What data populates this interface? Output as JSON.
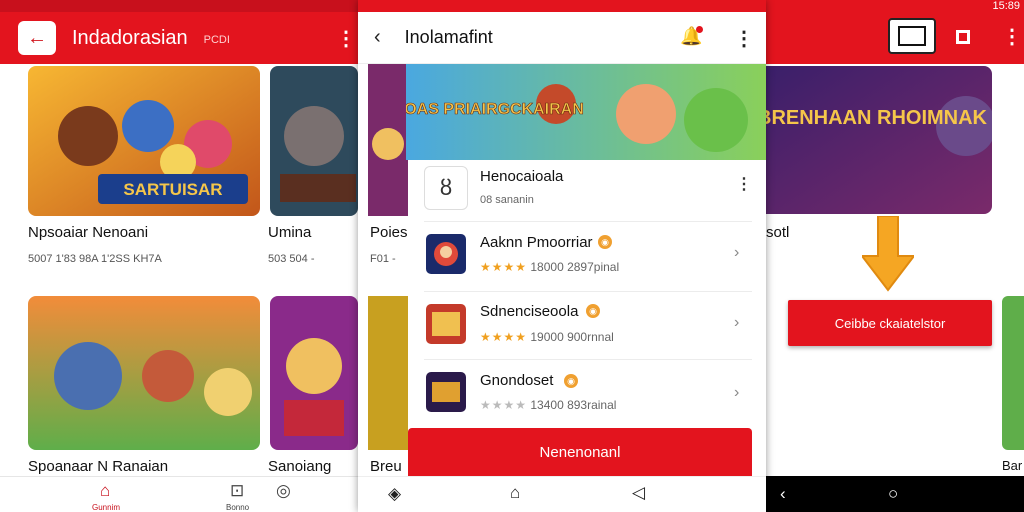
{
  "left_screen": {
    "title": "Indadorasian",
    "subtitle": "PCDI",
    "cards": [
      {
        "title": "Npsoaiar Nenoani",
        "meta": "5007 1'83 98A 1'2SS KH7A",
        "banner_text": "SARTUISAR"
      },
      {
        "title": "Umina",
        "meta": "503 504 -"
      },
      {
        "title": "Spoanaar N Ranaian",
        "meta": ""
      },
      {
        "title": "Sanoiang",
        "meta": ""
      }
    ],
    "nav": {
      "home_label": "Gunnim",
      "tab2_label": "Bonno"
    }
  },
  "center_screen": {
    "title": "Inolamafint",
    "banner_text": "FAROAS PRIAIRGCKAIRAN",
    "list_header": {
      "title": "Henocaioala",
      "subtitle": "08 sananin"
    },
    "apps": [
      {
        "name": "Aaknn Pmoorriar",
        "rating_text": "18000 2897pinal",
        "stars": "★★★★"
      },
      {
        "name": "Sdnenciseoola",
        "rating_text": "19000  900rnnal",
        "stars": "★★★★"
      },
      {
        "name": "Gnondoset",
        "rating_text": "13400  893rainal",
        "stars": "★★★★"
      }
    ],
    "install_label": "Nenenonanl",
    "behind_title": "Poies",
    "behind_meta": "F01 -",
    "behind_bottom": "Breu"
  },
  "right_screen": {
    "clock": "15:89",
    "banner_text": "BRENHAAN RHOIMNAK",
    "caption": "sotl",
    "cta_label": "Ceibbe ckaiatelstor",
    "bottom_text": "Bar"
  },
  "colors": {
    "brand_red": "#e3141e",
    "accent_orange": "#f0a030"
  }
}
